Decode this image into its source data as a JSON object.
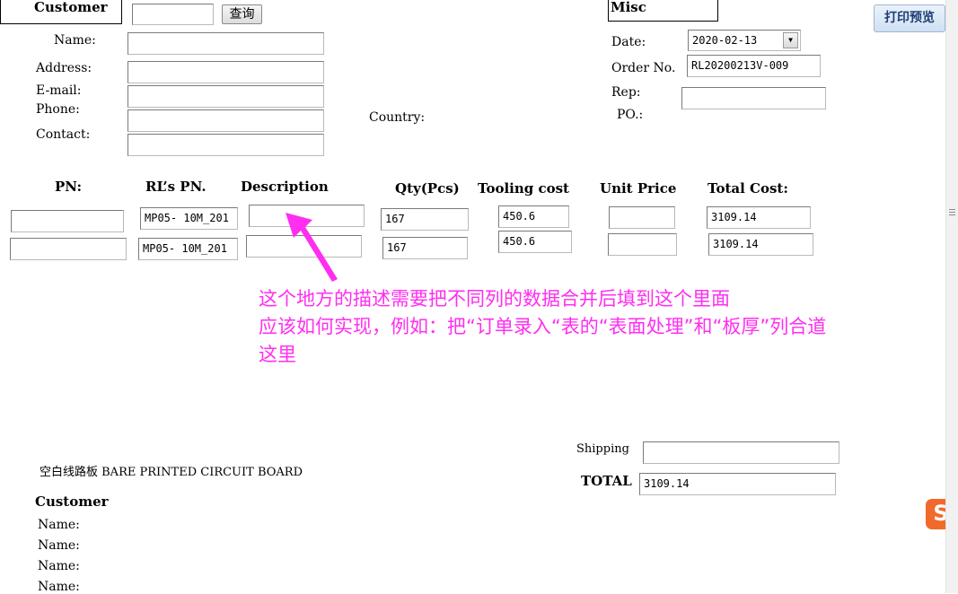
{
  "customer": {
    "title": "Customer",
    "search_button": "查询",
    "name_label": "Name:",
    "address_label": "Address:",
    "email_label": "E-mail:",
    "phone_label": "Phone:",
    "contact_label": "Contact:",
    "country_label": "Country:"
  },
  "misc": {
    "title": "Misc",
    "date_label": "Date:",
    "date_value": "2020-02-13",
    "order_label": "Order No.",
    "order_value": "RL20200213V-009",
    "rep_label": "Rep:",
    "po_label": "PO.:"
  },
  "print_button": "打印预览",
  "table": {
    "headers": {
      "pn": "PN:",
      "rl_pn": "RL’s PN.",
      "description": "Description",
      "qty": "Qty(Pcs)",
      "tooling": "Tooling cost",
      "unit_price": "Unit Price",
      "total_cost": "Total Cost:"
    },
    "rows": [
      {
        "pn": "",
        "rl_pn": "MP05- 10M_201",
        "description": "",
        "qty": "167",
        "tooling": "450.6",
        "unit_price": "",
        "total": "3109.14"
      },
      {
        "pn": "",
        "rl_pn": "MP05- 10M_201",
        "description": "",
        "qty": "167",
        "tooling": "450.6",
        "unit_price": "",
        "total": "3109.14"
      }
    ]
  },
  "annotation": {
    "line1": "这个地方的描述需要把不同列的数据合并后填到这个里面",
    "line2": "应该如何实现，例如：把“订单录入“表的“表面处理”和“板厚”列合道",
    "line3": "这里",
    "color": "#ff2ef0"
  },
  "footer": {
    "board_text": "空白线路板 BARE PRINTED CIRCUIT BOARD",
    "shipping_label": "Shipping",
    "shipping_value": "",
    "total_label": "TOTAL",
    "total_value": "3109.14",
    "customer_title": "Customer",
    "name_lines": [
      "Name:",
      "Name:",
      "Name:",
      "Name:"
    ]
  },
  "icons": {
    "sogou": "sogou-ime-icon",
    "date_dropdown": "chevron-down-icon"
  }
}
